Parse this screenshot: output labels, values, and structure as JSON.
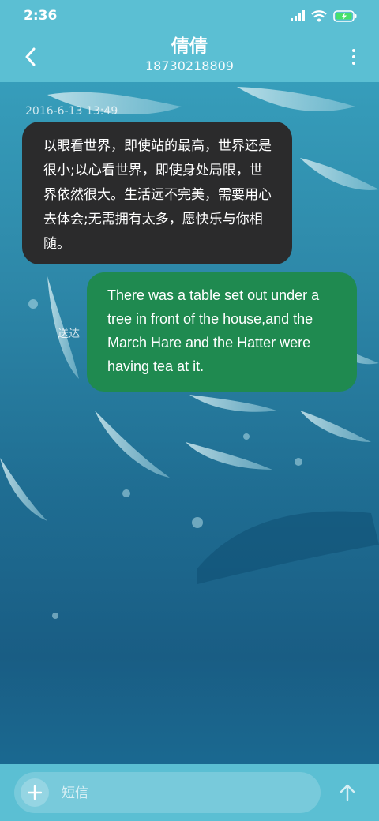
{
  "status_bar": {
    "time": "2:36"
  },
  "header": {
    "contact_name": "倩倩",
    "contact_number": "18730218809"
  },
  "messages": [
    {
      "direction": "incoming",
      "timestamp": "2016-6-13 13:49",
      "text": "以眼看世界，即使站的最高，世界还是很小;以心看世界，即使身处局限，世界依然很大。生活远不完美，需要用心去体会;无需拥有太多，愿快乐与你相随。"
    },
    {
      "direction": "outgoing",
      "status": "送达",
      "text": "There was a table set out under a tree in front of the house,and the March Hare and the Hatter were having tea at it."
    }
  ],
  "composer": {
    "placeholder": "短信"
  },
  "colors": {
    "header": "#5bbfd3",
    "incoming_bubble": "#2b2b2c",
    "outgoing_bubble": "#1f8a50"
  },
  "icons": [
    "signal-icon",
    "wifi-icon",
    "battery-icon",
    "back-arrow-icon",
    "more-icon",
    "add-icon",
    "send-icon"
  ]
}
